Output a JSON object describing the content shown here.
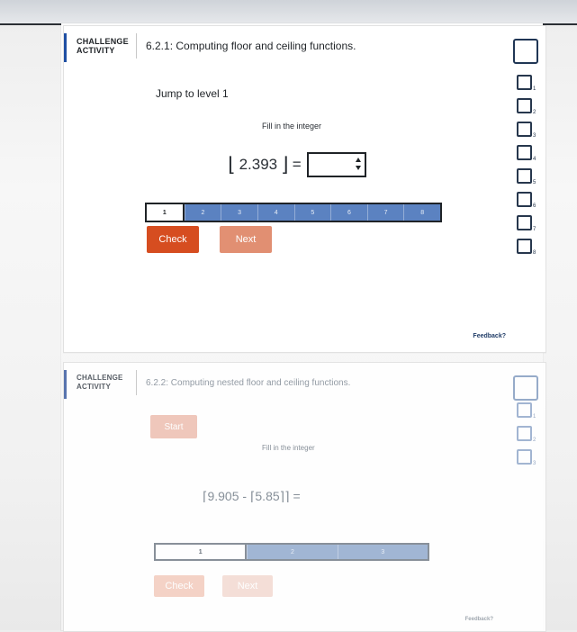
{
  "activity1": {
    "tag_line1": "CHALLENGE",
    "tag_line2": "ACTIVITY",
    "title": "6.2.1: Computing floor and ceiling functions.",
    "jump_label": "Jump to level 1",
    "instruction": "Fill in the integer",
    "expression": {
      "left_bracket": "⌊",
      "value": "2.393",
      "right_bracket": "⌋",
      "equals": "="
    },
    "input_value": "",
    "progress_segments": [
      "1",
      "2",
      "3",
      "4",
      "5",
      "6",
      "7",
      "8"
    ],
    "buttons": {
      "check": "Check",
      "next": "Next"
    },
    "levels": [
      "1",
      "2",
      "3",
      "4",
      "5",
      "6",
      "7",
      "8"
    ],
    "feedback": "Feedback?"
  },
  "activity2": {
    "tag_line1": "CHALLENGE",
    "tag_line2": "ACTIVITY",
    "title": "6.2.2: Computing nested floor and ceiling functions.",
    "start": "Start",
    "instruction": "Fill in the integer",
    "expression_text": "⌈9.905 - ⌈5.85⌉⌉ =",
    "progress_segments": [
      "1",
      "2",
      "3"
    ],
    "buttons": {
      "check": "Check",
      "next": "Next"
    },
    "levels": [
      "1",
      "2",
      "3"
    ],
    "feedback": "Feedback?"
  },
  "colors": {
    "accent_blue": "#1f4fa3",
    "check_orange": "#d64d20",
    "next_orange": "#e08a6b",
    "progress_blue": "#5b82c1"
  },
  "icons": {
    "collapse": "collapse-toggle-icon",
    "level_box": "level-box-icon",
    "spinner": "spinner-icon"
  }
}
